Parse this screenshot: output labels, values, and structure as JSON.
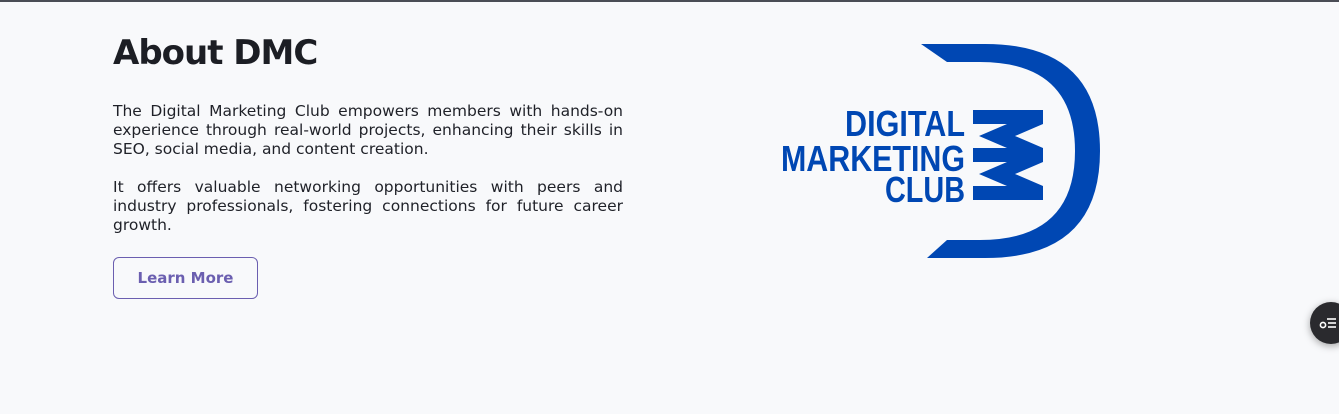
{
  "about": {
    "title": "About DMC",
    "paragraph_1": "The Digital Marketing Club empowers members with hands-on experience through real-world projects, enhancing their skills in SEO, social media, and content creation.",
    "paragraph_2": "It offers valuable networking opportunities with peers and industry professionals, fostering connections for future career growth.",
    "button_label": "Learn More"
  },
  "logo": {
    "line_1": "DIGITAL",
    "line_2": "MARKETING",
    "line_3": "CLUB",
    "color": "#0047b3"
  },
  "fab": {
    "icon": "settings-list-icon"
  },
  "colors": {
    "background": "#f8f9fb",
    "accent": "#6b5fb0",
    "text": "#1c1e24",
    "brand_blue": "#0047b3"
  }
}
